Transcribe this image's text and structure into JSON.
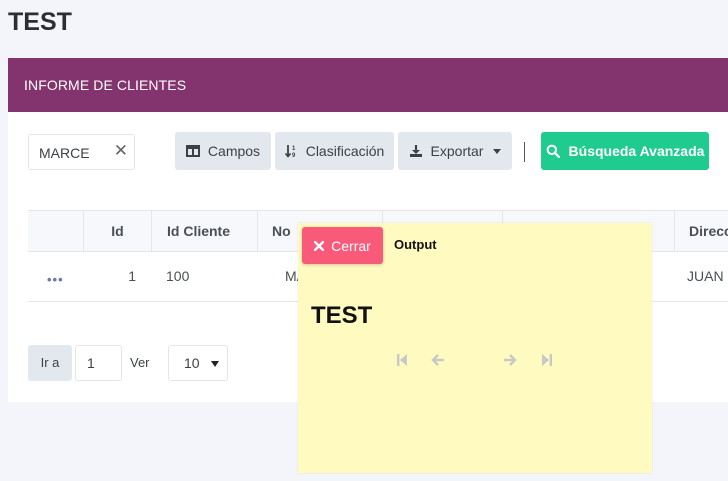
{
  "page": {
    "title": "TEST"
  },
  "card": {
    "header": "INFORME DE CLIENTES"
  },
  "toolbar": {
    "search_value": "MARCE",
    "clear_symbol": "✕",
    "campos": "Campos",
    "clasificacion": "Clasificación",
    "exportar": "Exportar",
    "busqueda_avanzada": "Búsqueda Avanzada"
  },
  "table": {
    "columns": [
      "Id",
      "Id Cliente",
      "No",
      "Direcci"
    ],
    "rows": [
      {
        "actions": "•••",
        "id": "1",
        "id_cliente": "100",
        "nombre": "MA",
        "direccion": "JUAN D"
      }
    ]
  },
  "pager": {
    "go_label": "Ir a",
    "page": "1",
    "ver_label": "Ver",
    "page_size": "10"
  },
  "popup": {
    "close_label": "Cerrar",
    "title": "Output",
    "heading": "TEST",
    "nav_icons": [
      "first-page-icon",
      "prev-page-icon",
      "next-page-icon",
      "last-page-icon"
    ]
  },
  "colors": {
    "header": "#83346e",
    "primary_green": "#1fcb8e",
    "close_red": "#fa5a7a",
    "popup_bg": "#fffac0"
  }
}
